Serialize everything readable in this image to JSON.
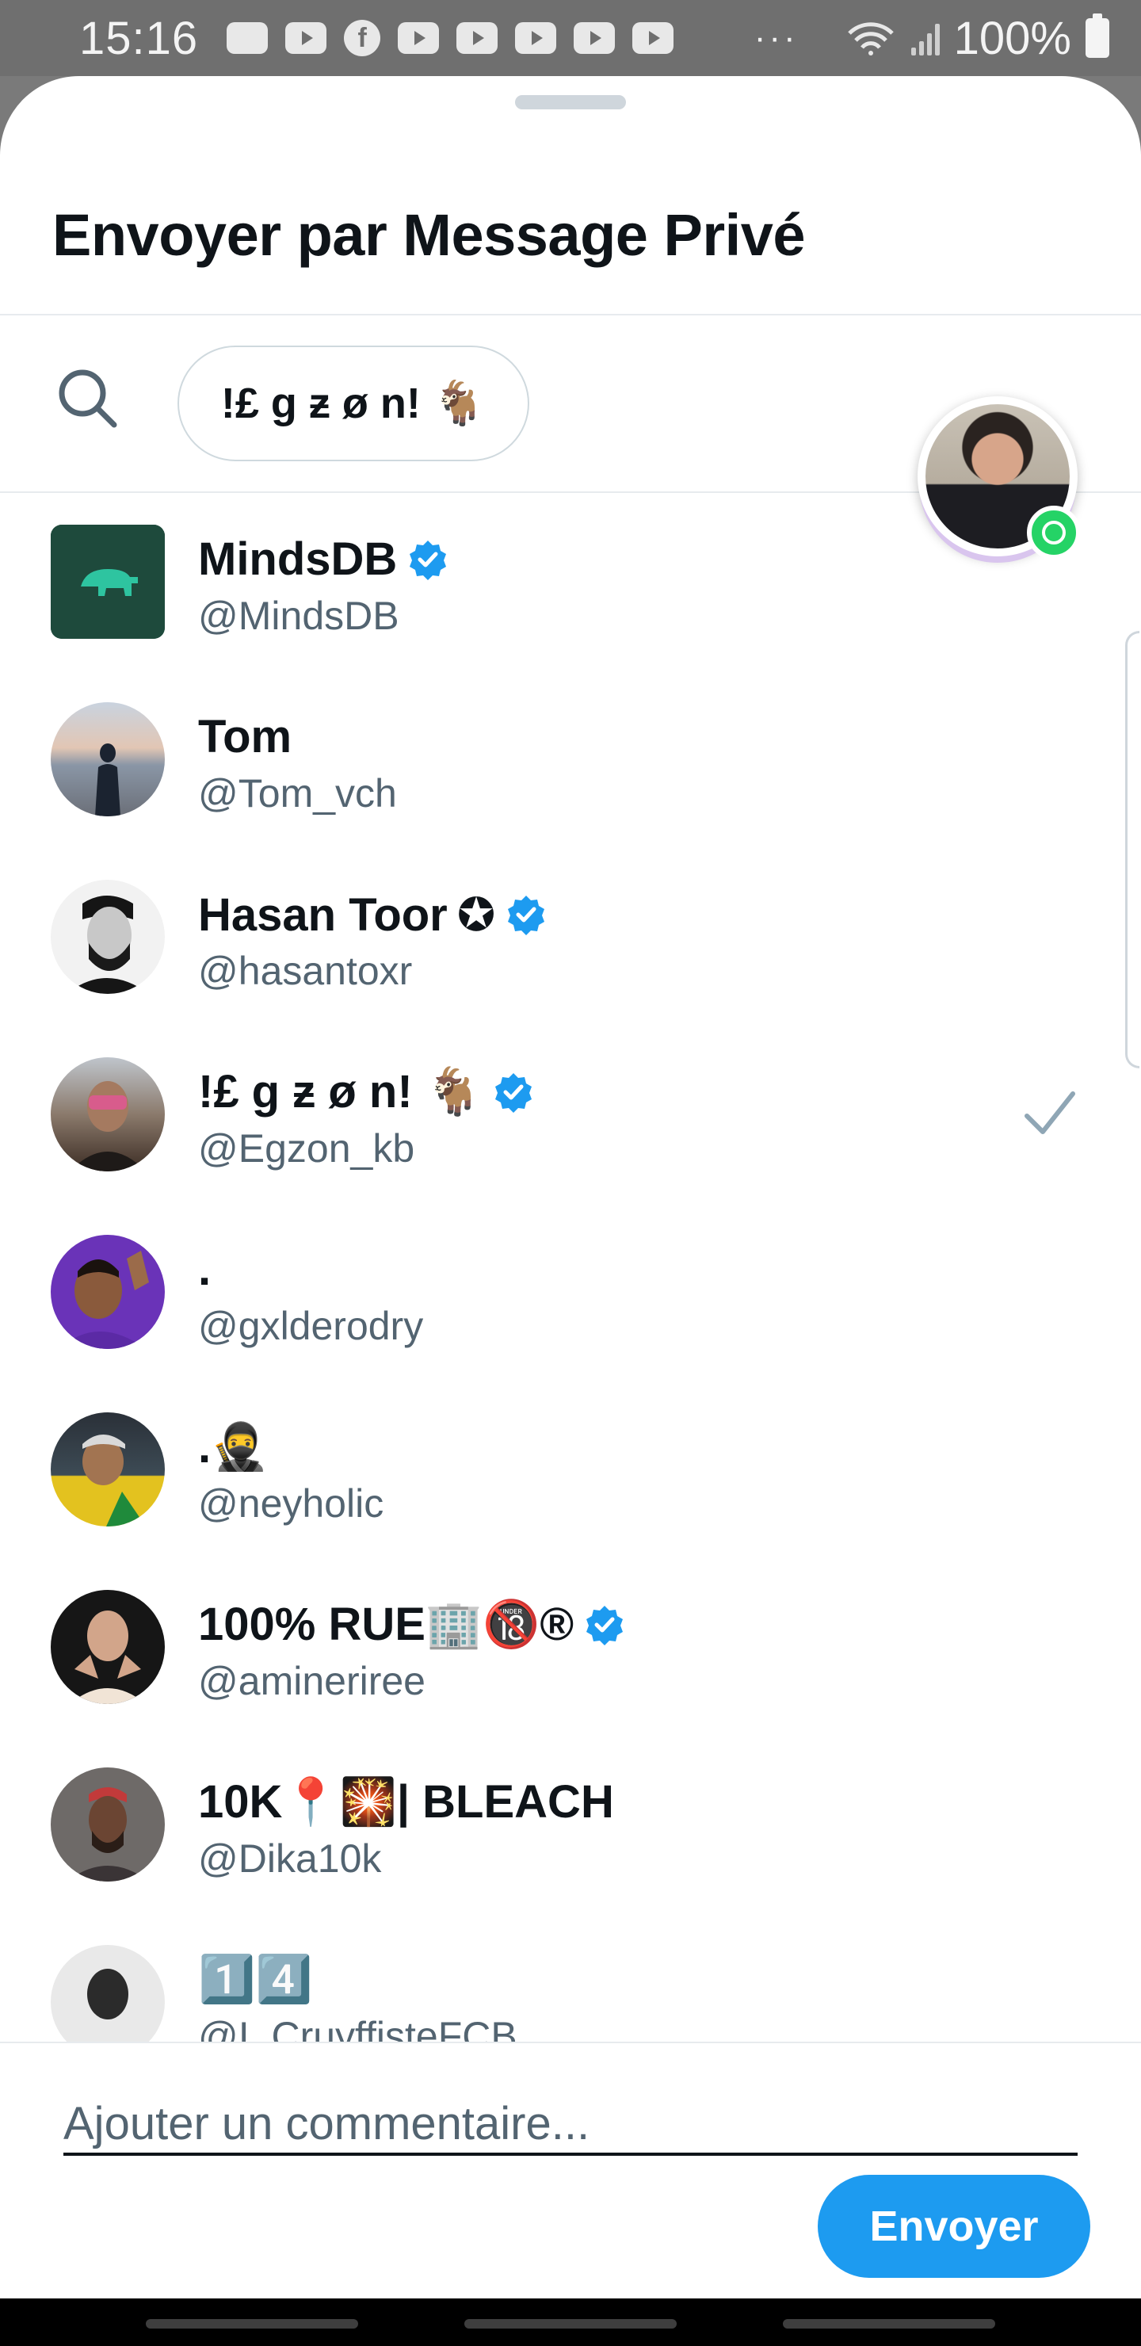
{
  "status_bar": {
    "time": "15:16",
    "battery": "100%",
    "icons": [
      "message-icon",
      "video-icon",
      "facebook-icon",
      "youtube-icon",
      "youtube-icon",
      "youtube-icon",
      "youtube-icon",
      "youtube-icon",
      "more-dots-icon",
      "wifi-icon",
      "signal-icon",
      "battery-icon"
    ]
  },
  "sheet": {
    "title": "Envoyer par Message Privé",
    "selected_chip": "!£ g ƶ ø n! 🐐"
  },
  "contacts": [
    {
      "name": "MindsDB",
      "handle": "@MindsDB",
      "verified": true,
      "badge": "",
      "selected": false
    },
    {
      "name": "Tom",
      "handle": "@Tom_vch",
      "verified": false,
      "badge": "",
      "selected": false
    },
    {
      "name": "Hasan Toor",
      "handle": "@hasantoxr",
      "verified": true,
      "badge": "✪",
      "selected": false
    },
    {
      "name": "!£ g ƶ ø n! 🐐",
      "handle": "@Egzon_kb",
      "verified": true,
      "badge": "",
      "selected": true
    },
    {
      "name": ".",
      "handle": "@gxlderodry",
      "verified": false,
      "badge": "",
      "selected": false
    },
    {
      "name": ".🥷",
      "handle": "@neyholic",
      "verified": false,
      "badge": "",
      "selected": false
    },
    {
      "name": "100% RUE🏢🔞®",
      "handle": "@amineriree",
      "verified": true,
      "badge": "",
      "selected": false
    },
    {
      "name": "10K📍🎇| BLEACH",
      "handle": "@Dika10k",
      "verified": false,
      "badge": "",
      "selected": false
    },
    {
      "name": "1️⃣4️⃣",
      "handle": "@I_CruyffisteFCB",
      "verified": false,
      "badge": "",
      "selected": false
    }
  ],
  "comment": {
    "placeholder": "Ajouter un commentaire...",
    "send_label": "Envoyer"
  },
  "colors": {
    "accent": "#1d9bf0",
    "text_primary": "#0f1419",
    "text_secondary": "#536471",
    "whatsapp": "#25d366"
  }
}
